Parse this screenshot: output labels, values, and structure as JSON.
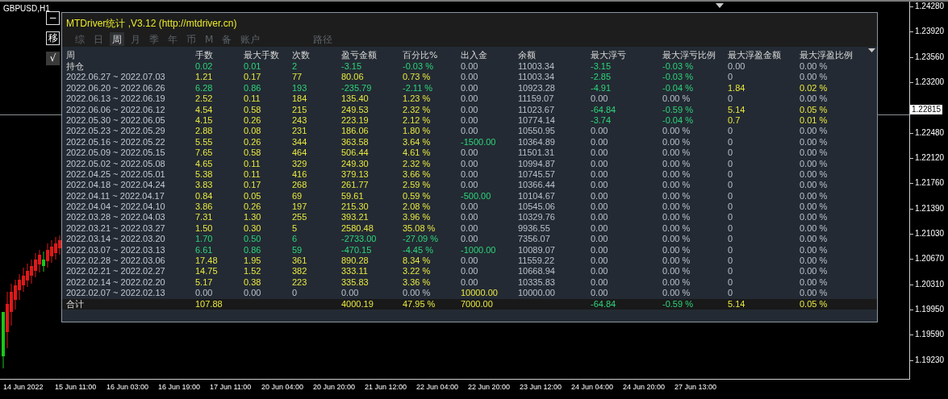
{
  "chart": {
    "symbol": "GBPUSD,H1",
    "price_labels": [
      {
        "text": "1.24280",
        "kind": "tick"
      },
      {
        "text": "1.23920",
        "kind": "tick"
      },
      {
        "text": "1.23560",
        "kind": "tick"
      },
      {
        "text": "1.23200",
        "kind": "tick"
      },
      {
        "text": "1.22815",
        "kind": "current"
      },
      {
        "text": "1.22480",
        "kind": "tick"
      },
      {
        "text": "1.22120",
        "kind": "tick"
      },
      {
        "text": "1.21760",
        "kind": "tick"
      },
      {
        "text": "1.21390",
        "kind": "tick"
      },
      {
        "text": "1.21030",
        "kind": "tick"
      },
      {
        "text": "1.20670",
        "kind": "tick"
      },
      {
        "text": "1.20310",
        "kind": "tick"
      },
      {
        "text": "1.19950",
        "kind": "tick"
      },
      {
        "text": "1.19590",
        "kind": "tick"
      },
      {
        "text": "1.19230",
        "kind": "tick"
      }
    ],
    "time_labels": [
      "14 Jun 2022",
      "15 Jun 11:00",
      "16 Jun 03:00",
      "16 Jun 19:00",
      "17 Jun 11:00",
      "20 Jun 04:00",
      "20 Jun 20:00",
      "21 Jun 12:00",
      "22 Jun 04:00",
      "22 Jun 20:00",
      "23 Jun 12:00",
      "24 Jun 04:00",
      "24 Jun 20:00",
      "27 Jun 13:00"
    ]
  },
  "side_buttons": [
    {
      "label": "−",
      "kind": "outline"
    },
    {
      "label": "移",
      "kind": "outline"
    },
    {
      "label": "√",
      "kind": "filled"
    }
  ],
  "panel": {
    "title": "MTDriver统计 ,V3.12 (http://mtdriver.cn)",
    "tabs": [
      {
        "label": "综",
        "selected": false
      },
      {
        "label": "日",
        "selected": false
      },
      {
        "label": "周",
        "selected": true
      },
      {
        "label": "月",
        "selected": false
      },
      {
        "label": "季",
        "selected": false
      },
      {
        "label": "年",
        "selected": false
      },
      {
        "label": "币",
        "selected": false
      },
      {
        "label": "M",
        "selected": false
      },
      {
        "label": "备",
        "selected": false
      },
      {
        "label": "账户",
        "selected": false
      }
    ],
    "path_label": "路径",
    "columns": [
      "周",
      "手数",
      "最大手数",
      "次数",
      "盈亏金额",
      "百分比%",
      "出入金",
      "余额",
      "最大浮亏",
      "最大浮亏比例",
      "最大浮盈金额",
      "最大浮盈比例"
    ],
    "rows": [
      {
        "cells": [
          {
            "text": "持仓",
            "kind": "label"
          },
          {
            "text": "0.02",
            "kind": "down"
          },
          {
            "text": "0.01",
            "kind": "down"
          },
          {
            "text": "2",
            "kind": "down"
          },
          {
            "text": "-3.15",
            "kind": "down"
          },
          {
            "text": "-0.03 %",
            "kind": "down"
          },
          {
            "text": "0.00",
            "kind": "flat"
          },
          {
            "text": "11003.34",
            "kind": "flat"
          },
          {
            "text": "-3.15",
            "kind": "down"
          },
          {
            "text": "-0.03 %",
            "kind": "down"
          },
          {
            "text": "0.00",
            "kind": "flat"
          },
          {
            "text": "0.00 %",
            "kind": "flat"
          }
        ]
      },
      {
        "cells": [
          {
            "text": "2022.06.27 ~ 2022.07.03",
            "kind": "label"
          },
          {
            "text": "1.21",
            "kind": "up"
          },
          {
            "text": "0.17",
            "kind": "up"
          },
          {
            "text": "77",
            "kind": "up"
          },
          {
            "text": "80.06",
            "kind": "up"
          },
          {
            "text": "0.73 %",
            "kind": "up"
          },
          {
            "text": "0.00",
            "kind": "flat"
          },
          {
            "text": "11003.34",
            "kind": "flat"
          },
          {
            "text": "-2.85",
            "kind": "down"
          },
          {
            "text": "-0.03 %",
            "kind": "down"
          },
          {
            "text": "0",
            "kind": "flat"
          },
          {
            "text": "0.00 %",
            "kind": "flat"
          }
        ]
      },
      {
        "cells": [
          {
            "text": "2022.06.20 ~ 2022.06.26",
            "kind": "label"
          },
          {
            "text": "6.28",
            "kind": "down"
          },
          {
            "text": "0.86",
            "kind": "down"
          },
          {
            "text": "193",
            "kind": "down"
          },
          {
            "text": "-235.79",
            "kind": "down"
          },
          {
            "text": "-2.11 %",
            "kind": "down"
          },
          {
            "text": "0.00",
            "kind": "flat"
          },
          {
            "text": "10923.28",
            "kind": "flat"
          },
          {
            "text": "-4.91",
            "kind": "down"
          },
          {
            "text": "-0.04 %",
            "kind": "down"
          },
          {
            "text": "1.84",
            "kind": "up"
          },
          {
            "text": "0.02 %",
            "kind": "up"
          }
        ]
      },
      {
        "cells": [
          {
            "text": "2022.06.13 ~ 2022.06.19",
            "kind": "label"
          },
          {
            "text": "2.52",
            "kind": "up"
          },
          {
            "text": "0.11",
            "kind": "up"
          },
          {
            "text": "184",
            "kind": "up"
          },
          {
            "text": "135.40",
            "kind": "up"
          },
          {
            "text": "1.23 %",
            "kind": "up"
          },
          {
            "text": "0.00",
            "kind": "flat"
          },
          {
            "text": "11159.07",
            "kind": "flat"
          },
          {
            "text": "0.00",
            "kind": "flat"
          },
          {
            "text": "0.00 %",
            "kind": "flat"
          },
          {
            "text": "0",
            "kind": "flat"
          },
          {
            "text": "0.00 %",
            "kind": "flat"
          }
        ]
      },
      {
        "cells": [
          {
            "text": "2022.06.06 ~ 2022.06.12",
            "kind": "label"
          },
          {
            "text": "4.54",
            "kind": "up"
          },
          {
            "text": "0.58",
            "kind": "up"
          },
          {
            "text": "215",
            "kind": "up"
          },
          {
            "text": "249.53",
            "kind": "up"
          },
          {
            "text": "2.32 %",
            "kind": "up"
          },
          {
            "text": "0.00",
            "kind": "flat"
          },
          {
            "text": "11023.67",
            "kind": "flat"
          },
          {
            "text": "-64.84",
            "kind": "down"
          },
          {
            "text": "-0.59 %",
            "kind": "down"
          },
          {
            "text": "5.14",
            "kind": "up"
          },
          {
            "text": "0.05 %",
            "kind": "up"
          }
        ]
      },
      {
        "cells": [
          {
            "text": "2022.05.30 ~ 2022.06.05",
            "kind": "label"
          },
          {
            "text": "4.15",
            "kind": "up"
          },
          {
            "text": "0.26",
            "kind": "up"
          },
          {
            "text": "243",
            "kind": "up"
          },
          {
            "text": "223.19",
            "kind": "up"
          },
          {
            "text": "2.12 %",
            "kind": "up"
          },
          {
            "text": "0.00",
            "kind": "flat"
          },
          {
            "text": "10774.14",
            "kind": "flat"
          },
          {
            "text": "-3.74",
            "kind": "down"
          },
          {
            "text": "-0.04 %",
            "kind": "down"
          },
          {
            "text": "0.7",
            "kind": "up"
          },
          {
            "text": "0.01 %",
            "kind": "up"
          }
        ]
      },
      {
        "cells": [
          {
            "text": "2022.05.23 ~ 2022.05.29",
            "kind": "label"
          },
          {
            "text": "2.88",
            "kind": "up"
          },
          {
            "text": "0.08",
            "kind": "up"
          },
          {
            "text": "231",
            "kind": "up"
          },
          {
            "text": "186.06",
            "kind": "up"
          },
          {
            "text": "1.80 %",
            "kind": "up"
          },
          {
            "text": "0.00",
            "kind": "flat"
          },
          {
            "text": "10550.95",
            "kind": "flat"
          },
          {
            "text": "0.00",
            "kind": "flat"
          },
          {
            "text": "0.00 %",
            "kind": "flat"
          },
          {
            "text": "0",
            "kind": "flat"
          },
          {
            "text": "0.00 %",
            "kind": "flat"
          }
        ]
      },
      {
        "cells": [
          {
            "text": "2022.05.16 ~ 2022.05.22",
            "kind": "label"
          },
          {
            "text": "5.55",
            "kind": "up"
          },
          {
            "text": "0.26",
            "kind": "up"
          },
          {
            "text": "344",
            "kind": "up"
          },
          {
            "text": "363.58",
            "kind": "up"
          },
          {
            "text": "3.64 %",
            "kind": "up"
          },
          {
            "text": "-1500.00",
            "kind": "down"
          },
          {
            "text": "10364.89",
            "kind": "flat"
          },
          {
            "text": "0.00",
            "kind": "flat"
          },
          {
            "text": "0.00 %",
            "kind": "flat"
          },
          {
            "text": "0",
            "kind": "flat"
          },
          {
            "text": "0.00 %",
            "kind": "flat"
          }
        ]
      },
      {
        "cells": [
          {
            "text": "2022.05.09 ~ 2022.05.15",
            "kind": "label"
          },
          {
            "text": "7.65",
            "kind": "up"
          },
          {
            "text": "0.58",
            "kind": "up"
          },
          {
            "text": "464",
            "kind": "up"
          },
          {
            "text": "506.44",
            "kind": "up"
          },
          {
            "text": "4.61 %",
            "kind": "up"
          },
          {
            "text": "0.00",
            "kind": "flat"
          },
          {
            "text": "11501.31",
            "kind": "flat"
          },
          {
            "text": "0.00",
            "kind": "flat"
          },
          {
            "text": "0.00 %",
            "kind": "flat"
          },
          {
            "text": "0",
            "kind": "flat"
          },
          {
            "text": "0.00 %",
            "kind": "flat"
          }
        ]
      },
      {
        "cells": [
          {
            "text": "2022.05.02 ~ 2022.05.08",
            "kind": "label"
          },
          {
            "text": "4.65",
            "kind": "up"
          },
          {
            "text": "0.11",
            "kind": "up"
          },
          {
            "text": "329",
            "kind": "up"
          },
          {
            "text": "249.30",
            "kind": "up"
          },
          {
            "text": "2.32 %",
            "kind": "up"
          },
          {
            "text": "0.00",
            "kind": "flat"
          },
          {
            "text": "10994.87",
            "kind": "flat"
          },
          {
            "text": "0.00",
            "kind": "flat"
          },
          {
            "text": "0.00 %",
            "kind": "flat"
          },
          {
            "text": "0",
            "kind": "flat"
          },
          {
            "text": "0.00 %",
            "kind": "flat"
          }
        ]
      },
      {
        "cells": [
          {
            "text": "2022.04.25 ~ 2022.05.01",
            "kind": "label"
          },
          {
            "text": "5.38",
            "kind": "up"
          },
          {
            "text": "0.11",
            "kind": "up"
          },
          {
            "text": "416",
            "kind": "up"
          },
          {
            "text": "379.13",
            "kind": "up"
          },
          {
            "text": "3.66 %",
            "kind": "up"
          },
          {
            "text": "0.00",
            "kind": "flat"
          },
          {
            "text": "10745.57",
            "kind": "flat"
          },
          {
            "text": "0.00",
            "kind": "flat"
          },
          {
            "text": "0.00 %",
            "kind": "flat"
          },
          {
            "text": "0",
            "kind": "flat"
          },
          {
            "text": "0.00 %",
            "kind": "flat"
          }
        ]
      },
      {
        "cells": [
          {
            "text": "2022.04.18 ~ 2022.04.24",
            "kind": "label"
          },
          {
            "text": "3.83",
            "kind": "up"
          },
          {
            "text": "0.17",
            "kind": "up"
          },
          {
            "text": "268",
            "kind": "up"
          },
          {
            "text": "261.77",
            "kind": "up"
          },
          {
            "text": "2.59 %",
            "kind": "up"
          },
          {
            "text": "0.00",
            "kind": "flat"
          },
          {
            "text": "10366.44",
            "kind": "flat"
          },
          {
            "text": "0.00",
            "kind": "flat"
          },
          {
            "text": "0.00 %",
            "kind": "flat"
          },
          {
            "text": "0",
            "kind": "flat"
          },
          {
            "text": "0.00 %",
            "kind": "flat"
          }
        ]
      },
      {
        "cells": [
          {
            "text": "2022.04.11 ~ 2022.04.17",
            "kind": "label"
          },
          {
            "text": "0.84",
            "kind": "up"
          },
          {
            "text": "0.05",
            "kind": "up"
          },
          {
            "text": "69",
            "kind": "up"
          },
          {
            "text": "59.61",
            "kind": "up"
          },
          {
            "text": "0.59 %",
            "kind": "up"
          },
          {
            "text": "-500.00",
            "kind": "down"
          },
          {
            "text": "10104.67",
            "kind": "flat"
          },
          {
            "text": "0.00",
            "kind": "flat"
          },
          {
            "text": "0.00 %",
            "kind": "flat"
          },
          {
            "text": "0",
            "kind": "flat"
          },
          {
            "text": "0.00 %",
            "kind": "flat"
          }
        ]
      },
      {
        "cells": [
          {
            "text": "2022.04.04 ~ 2022.04.10",
            "kind": "label"
          },
          {
            "text": "3.86",
            "kind": "up"
          },
          {
            "text": "0.26",
            "kind": "up"
          },
          {
            "text": "197",
            "kind": "up"
          },
          {
            "text": "215.30",
            "kind": "up"
          },
          {
            "text": "2.08 %",
            "kind": "up"
          },
          {
            "text": "0.00",
            "kind": "flat"
          },
          {
            "text": "10545.06",
            "kind": "flat"
          },
          {
            "text": "0.00",
            "kind": "flat"
          },
          {
            "text": "0.00 %",
            "kind": "flat"
          },
          {
            "text": "0",
            "kind": "flat"
          },
          {
            "text": "0.00 %",
            "kind": "flat"
          }
        ]
      },
      {
        "cells": [
          {
            "text": "2022.03.28 ~ 2022.04.03",
            "kind": "label"
          },
          {
            "text": "7.31",
            "kind": "up"
          },
          {
            "text": "1.30",
            "kind": "up"
          },
          {
            "text": "255",
            "kind": "up"
          },
          {
            "text": "393.21",
            "kind": "up"
          },
          {
            "text": "3.96 %",
            "kind": "up"
          },
          {
            "text": "0.00",
            "kind": "flat"
          },
          {
            "text": "10329.76",
            "kind": "flat"
          },
          {
            "text": "0.00",
            "kind": "flat"
          },
          {
            "text": "0.00 %",
            "kind": "flat"
          },
          {
            "text": "0",
            "kind": "flat"
          },
          {
            "text": "0.00 %",
            "kind": "flat"
          }
        ]
      },
      {
        "cells": [
          {
            "text": "2022.03.21 ~ 2022.03.27",
            "kind": "label"
          },
          {
            "text": "1.50",
            "kind": "up"
          },
          {
            "text": "0.30",
            "kind": "up"
          },
          {
            "text": "5",
            "kind": "up"
          },
          {
            "text": "2580.48",
            "kind": "up"
          },
          {
            "text": "35.08 %",
            "kind": "up"
          },
          {
            "text": "0.00",
            "kind": "flat"
          },
          {
            "text": "9936.55",
            "kind": "flat"
          },
          {
            "text": "0.00",
            "kind": "flat"
          },
          {
            "text": "0.00 %",
            "kind": "flat"
          },
          {
            "text": "0",
            "kind": "flat"
          },
          {
            "text": "0.00 %",
            "kind": "flat"
          }
        ]
      },
      {
        "cells": [
          {
            "text": "2022.03.14 ~ 2022.03.20",
            "kind": "label"
          },
          {
            "text": "1.70",
            "kind": "down"
          },
          {
            "text": "0.50",
            "kind": "down"
          },
          {
            "text": "6",
            "kind": "down"
          },
          {
            "text": "-2733.00",
            "kind": "down"
          },
          {
            "text": "-27.09 %",
            "kind": "down"
          },
          {
            "text": "0.00",
            "kind": "flat"
          },
          {
            "text": "7356.07",
            "kind": "flat"
          },
          {
            "text": "0.00",
            "kind": "flat"
          },
          {
            "text": "0.00 %",
            "kind": "flat"
          },
          {
            "text": "0",
            "kind": "flat"
          },
          {
            "text": "0.00 %",
            "kind": "flat"
          }
        ]
      },
      {
        "cells": [
          {
            "text": "2022.03.07 ~ 2022.03.13",
            "kind": "label"
          },
          {
            "text": "6.61",
            "kind": "down"
          },
          {
            "text": "0.86",
            "kind": "down"
          },
          {
            "text": "59",
            "kind": "down"
          },
          {
            "text": "-470.15",
            "kind": "down"
          },
          {
            "text": "-4.45 %",
            "kind": "down"
          },
          {
            "text": "-1000.00",
            "kind": "down"
          },
          {
            "text": "10089.07",
            "kind": "flat"
          },
          {
            "text": "0.00",
            "kind": "flat"
          },
          {
            "text": "0.00 %",
            "kind": "flat"
          },
          {
            "text": "0",
            "kind": "flat"
          },
          {
            "text": "0.00 %",
            "kind": "flat"
          }
        ]
      },
      {
        "cells": [
          {
            "text": "2022.02.28 ~ 2022.03.06",
            "kind": "label"
          },
          {
            "text": "17.48",
            "kind": "up"
          },
          {
            "text": "1.95",
            "kind": "up"
          },
          {
            "text": "361",
            "kind": "up"
          },
          {
            "text": "890.28",
            "kind": "up"
          },
          {
            "text": "8.34 %",
            "kind": "up"
          },
          {
            "text": "0.00",
            "kind": "flat"
          },
          {
            "text": "11559.22",
            "kind": "flat"
          },
          {
            "text": "0.00",
            "kind": "flat"
          },
          {
            "text": "0.00 %",
            "kind": "flat"
          },
          {
            "text": "0",
            "kind": "flat"
          },
          {
            "text": "0.00 %",
            "kind": "flat"
          }
        ]
      },
      {
        "cells": [
          {
            "text": "2022.02.21 ~ 2022.02.27",
            "kind": "label"
          },
          {
            "text": "14.75",
            "kind": "up"
          },
          {
            "text": "1.52",
            "kind": "up"
          },
          {
            "text": "382",
            "kind": "up"
          },
          {
            "text": "333.11",
            "kind": "up"
          },
          {
            "text": "3.22 %",
            "kind": "up"
          },
          {
            "text": "0.00",
            "kind": "flat"
          },
          {
            "text": "10668.94",
            "kind": "flat"
          },
          {
            "text": "0.00",
            "kind": "flat"
          },
          {
            "text": "0.00 %",
            "kind": "flat"
          },
          {
            "text": "0",
            "kind": "flat"
          },
          {
            "text": "0.00 %",
            "kind": "flat"
          }
        ]
      },
      {
        "cells": [
          {
            "text": "2022.02.14 ~ 2022.02.20",
            "kind": "label"
          },
          {
            "text": "5.17",
            "kind": "up"
          },
          {
            "text": "0.38",
            "kind": "up"
          },
          {
            "text": "223",
            "kind": "up"
          },
          {
            "text": "335.83",
            "kind": "up"
          },
          {
            "text": "3.36 %",
            "kind": "up"
          },
          {
            "text": "0.00",
            "kind": "flat"
          },
          {
            "text": "10335.83",
            "kind": "flat"
          },
          {
            "text": "0.00",
            "kind": "flat"
          },
          {
            "text": "0.00 %",
            "kind": "flat"
          },
          {
            "text": "0",
            "kind": "flat"
          },
          {
            "text": "0.00 %",
            "kind": "flat"
          }
        ]
      },
      {
        "cells": [
          {
            "text": "2022.02.07 ~ 2022.02.13",
            "kind": "label"
          },
          {
            "text": "0.00",
            "kind": "flat"
          },
          {
            "text": "0.00",
            "kind": "flat"
          },
          {
            "text": "0",
            "kind": "flat"
          },
          {
            "text": "0.00",
            "kind": "flat"
          },
          {
            "text": "0.00 %",
            "kind": "flat"
          },
          {
            "text": "10000.00",
            "kind": "up"
          },
          {
            "text": "10000.00",
            "kind": "flat"
          },
          {
            "text": "0.00",
            "kind": "flat"
          },
          {
            "text": "0.00 %",
            "kind": "flat"
          },
          {
            "text": "0",
            "kind": "flat"
          },
          {
            "text": "0.00 %",
            "kind": "flat"
          }
        ]
      }
    ],
    "total": {
      "cells": [
        {
          "text": "合计",
          "kind": "label"
        },
        {
          "text": "107.88",
          "kind": "up"
        },
        {
          "text": ""
        },
        {
          "text": ""
        },
        {
          "text": "4000.19",
          "kind": "up"
        },
        {
          "text": "47.95 %",
          "kind": "up"
        },
        {
          "text": "7000.00",
          "kind": "up"
        },
        {
          "text": ""
        },
        {
          "text": "-64.84",
          "kind": "down"
        },
        {
          "text": "-0.59 %",
          "kind": "down"
        },
        {
          "text": "5.14",
          "kind": "up"
        },
        {
          "text": "0.05 %",
          "kind": "up"
        }
      ]
    }
  }
}
